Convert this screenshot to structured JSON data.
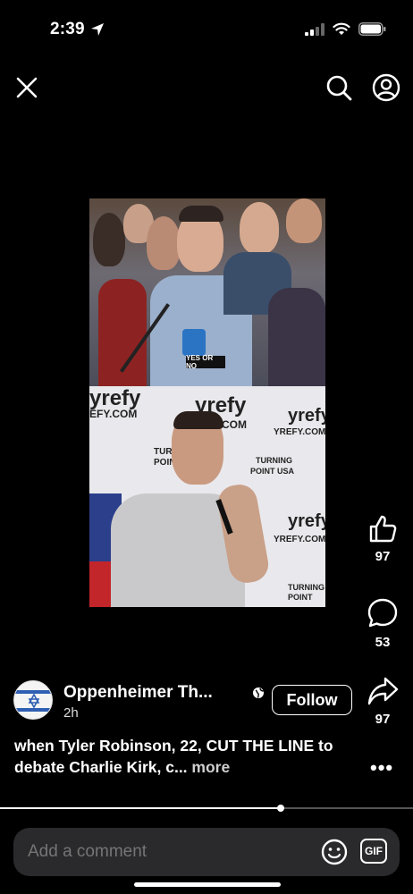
{
  "status_bar": {
    "time": "2:39",
    "icons": [
      "location-arrow-icon",
      "cellular-signal-icon",
      "wifi-icon",
      "battery-icon"
    ]
  },
  "top_bar": {
    "icons": [
      "close-icon",
      "search-icon",
      "profile-icon"
    ]
  },
  "video": {
    "backdrop_texts": [
      "yrefy",
      "EFY.COM",
      "yrefy",
      "COM",
      "yrefy",
      "YREFY.COM",
      "TURN",
      "POINT",
      "TURNING",
      "POINT USA",
      "yrefy",
      "YREFY.COM",
      "TURNING",
      "POINT"
    ],
    "sign_text": "YES OR NO"
  },
  "actions": {
    "likes": "97",
    "comments": "53",
    "shares": "97"
  },
  "post": {
    "author": "Oppenheimer Th...",
    "time": "2h",
    "follow_label": "Follow",
    "caption": "when Tyler Robinson, 22, CUT THE LINE to debate Charlie Kirk, c...",
    "more_label": "more",
    "more_options": "•••"
  },
  "progress": {
    "fraction": 0.68
  },
  "comment": {
    "placeholder": "Add a comment",
    "gif_label": "GIF"
  },
  "colors": {
    "background": "#000000",
    "comment_bar": "#2a2a2c",
    "text": "#ffffff"
  }
}
